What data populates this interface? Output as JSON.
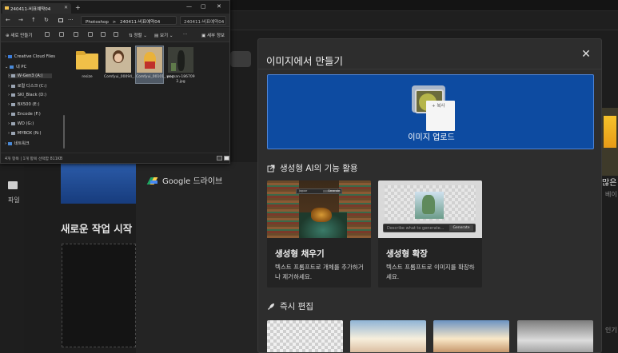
{
  "modal": {
    "title": "이미지에서 만들기",
    "close_glyph": "✕",
    "upload": {
      "label": "이미지 업로드",
      "drag_tag": "+ 복사"
    },
    "gen_section": {
      "title": "생성형 AI의 기능 활용"
    },
    "cards": [
      {
        "title": "생성형 채우기",
        "desc": "텍스트 프롬프트로 개체를 추가하거나 제거하세요.",
        "thumb_generate": "Generate",
        "thumb_input": "Jaguar"
      },
      {
        "title": "생성형 확장",
        "desc": "텍스트 프롬프트로 이미지를 확장하세요.",
        "thumb_placeholder": "Describe what to generate...",
        "thumb_generate": "Generate"
      }
    ],
    "quick_section": {
      "title": "즉시 편집"
    }
  },
  "background": {
    "gdrive_label": "Google 드라이브",
    "new_work_title": "새로운 작업 시작",
    "rail_label": "파일",
    "right_text1": "많은",
    "right_text2": "베이",
    "right_text3": "인기"
  },
  "explorer": {
    "tab_title": "240411-비표예약04",
    "new_tab": "+",
    "window_controls": [
      "—",
      "▢",
      "✕"
    ],
    "nav": {
      "back": "←",
      "forward": "→",
      "up": "↑",
      "refresh": "↻",
      "more": "···"
    },
    "address": [
      "Photoshop",
      "240411-비표예약04"
    ],
    "address_sep": ">",
    "search_placeholder": "240411-비표예약04 검색",
    "toolbar": {
      "new": "새로 만들기",
      "sort": "정렬",
      "view": "보기",
      "more": "···",
      "details": "세부 정보"
    },
    "sidebar": [
      {
        "label": "Creative Cloud Files",
        "color": "#3b7ddc",
        "expander": "›"
      },
      {
        "label": "내 PC",
        "color": "#4a8ad8",
        "expander": "⌄"
      },
      {
        "label": "W-Gen3 (A:)",
        "color": "#9aa4b2",
        "expander": "›"
      },
      {
        "label": "로컬 디스크 (C:)",
        "color": "#9aa4b2",
        "expander": "›"
      },
      {
        "label": "SKI_Black (D:)",
        "color": "#9aa4b2",
        "expander": "›"
      },
      {
        "label": "BX500 (E:)",
        "color": "#9aa4b2",
        "expander": "›"
      },
      {
        "label": "Encode (F:)",
        "color": "#9aa4b2",
        "expander": "›"
      },
      {
        "label": "WD (G:)",
        "color": "#9aa4b2",
        "expander": "›"
      },
      {
        "label": "MYBOX (N:)",
        "color": "#9aa4b2",
        "expander": "›"
      },
      {
        "label": "네트워크",
        "color": "#4a8ad8",
        "expander": "›"
      }
    ],
    "files": [
      {
        "name": "resize",
        "kind": "folder"
      },
      {
        "name": "Comfyui_00094_.png",
        "kind": "image"
      },
      {
        "name": "Comfyui_00101_.png",
        "kind": "image",
        "selected": true
      },
      {
        "name": "woman-186709 2.jpg",
        "kind": "image"
      }
    ],
    "status": "4개 항목 | 1개 항목 선택함 811KB"
  }
}
